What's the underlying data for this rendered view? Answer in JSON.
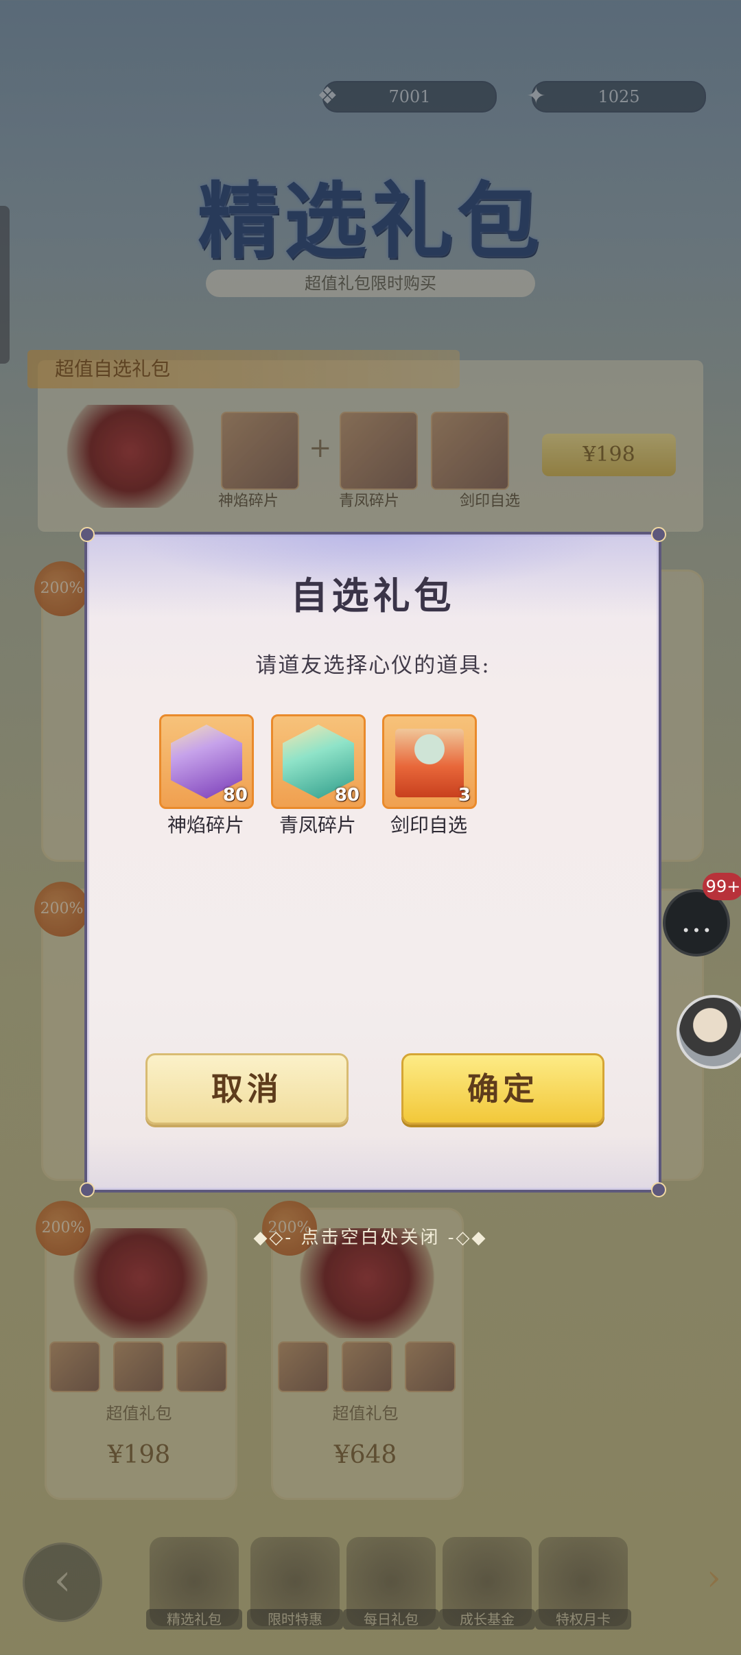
{
  "background": {
    "banner_title": "精选礼包",
    "banner_subtitle": "超值礼包限时购买",
    "resource_1": "7001",
    "resource_2": "1025",
    "featured_ribbon": "超值自选礼包",
    "featured_price": "¥198",
    "featured_items": [
      "神焰碎片",
      "青凤碎片",
      "剑印自选"
    ],
    "card_percent": "200%",
    "card_name": "超值礼包",
    "card_prices": [
      "¥198",
      "¥648"
    ],
    "nav_labels": [
      "精选礼包",
      "限时特惠",
      "每日礼包",
      "成长基金",
      "特权月卡"
    ]
  },
  "modal": {
    "title": "自选礼包",
    "prompt": "请道友选择心仪的道具:",
    "items": [
      {
        "name": "神焰碎片",
        "count": "80",
        "icon": "purple-robe-icon",
        "color": "#8a5cc8"
      },
      {
        "name": "青凤碎片",
        "count": "80",
        "icon": "teal-robe-icon",
        "color": "#4fc2a8"
      },
      {
        "name": "剑印自选",
        "count": "3",
        "icon": "treasure-chest-icon",
        "color": "#e2603a"
      }
    ],
    "cancel_label": "取消",
    "confirm_label": "确定"
  },
  "close_hint": "点击空白处关闭",
  "chat": {
    "badge": "99+"
  }
}
